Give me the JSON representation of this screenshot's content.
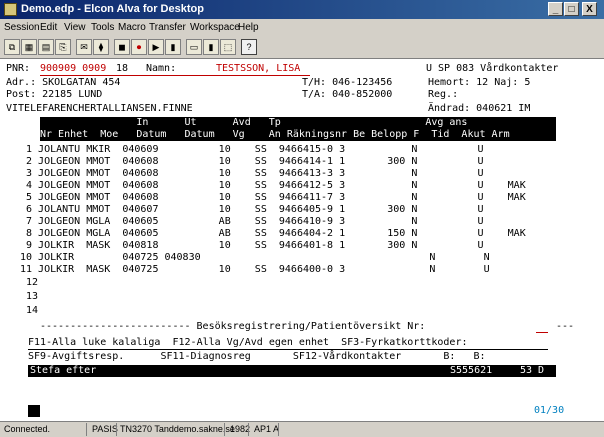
{
  "window": {
    "title": "Demo.edp - Elcon Alva for Desktop",
    "min_label": "_",
    "max_label": "□",
    "close_label": "X"
  },
  "menu": [
    "Session",
    "Edit",
    "View",
    "Tools",
    "Macro",
    "Transfer",
    "Workspace",
    "Help"
  ],
  "toolbar": [
    "⧉",
    "▦",
    "▤",
    "⎘",
    "✉",
    "⧫",
    "◼",
    "⏺",
    "▶",
    "▮",
    "▭",
    "▮",
    "⬚",
    "?"
  ],
  "screen": {
    "header_left": "PNR:",
    "pnr_value": "900909 0909",
    "kon_label": "Namn:",
    "kon_value": "18",
    "name_value": "TESTSSON, LISA",
    "status_right": "U SP 083 Vårdkontakter",
    "adr_line": "Adr.: SKOLGATAN 454",
    "tel_line": "T/H: 046-123456",
    "hemort_line": "Hemort: 12 Naj: 5",
    "post_line": "Post: 22185 LUND",
    "tela_line": "T/A: 040-852000",
    "reg_line": "Reg.:",
    "vardgivare_line": "VITELEFARENCHERTALLIANSEN.FINNE",
    "andrad_line": "Ändrad: 040621 IM",
    "col_head1": "                In      Ut      Avd   Tp                        Avg ans",
    "col_head2": "Nr Enhet  Moe   Datum   Datum   Vg    An Räkningsnr Be Belopp F  Tid  Akut Arm",
    "rows": [
      "11 JOLKIR  MASK  040725          10    SS  9466400-0 3              N        U",
      "10 JOLKIR        040725 040830                                      N        N",
      " 9 JOLKIR  MASK  040818          10    SS  9466401-8 1       300 N          U",
      " 8 JOLGEON MGLA  040605          AB    SS  9466404-2 1       150 N          U    MAK",
      " 7 JOLGEON MGLA  040605          AB    SS  9466410-9 3           N          U",
      " 6 JOLANTU MMOT  040607          10    SS  9466405-9 1       300 N          U",
      " 5 JOLGEON MMOT  040608          10    SS  9466411-7 3           N          U    MAK",
      " 4 JOLGEON MMOT  040608          10    SS  9466412-5 3           N          U    MAK",
      " 3 JOLGEON MMOT  040608          10    SS  9466413-3 3           N          U",
      " 2 JOLGEON MMOT  040608          10    SS  9466414-1 1       300 N          U",
      " 1 JOLANTU MKIR  040609          10    SS  9466415-0 3           N          U"
    ],
    "empty_rows": [
      "12",
      "13",
      "14"
    ],
    "section_divider": "------------------------- Besöksregistrering/Patientöversikt Nr:",
    "section_tail": "---",
    "fkeys": "F11-Alla luke kalaliga  F12-Alla Vg/Avd egen enhet  SF3-Fyrkatkorttkoder:",
    "sf9_line": "SF9-Avgiftsresp.      SF11-Diagnosreg       SF12-Vårdkontakter       B:   B:",
    "nav_left": "Stefa efter",
    "nav_code": "S555621",
    "nav_num": "53 D",
    "screen_num": "01/30",
    "cursor_block": "  "
  },
  "status": {
    "conn": "Connected.",
    "mode": "PASIS",
    "host": "TN3270 Tanddemo.sakne.se",
    "port": "1982",
    "field": "AP1 A"
  }
}
